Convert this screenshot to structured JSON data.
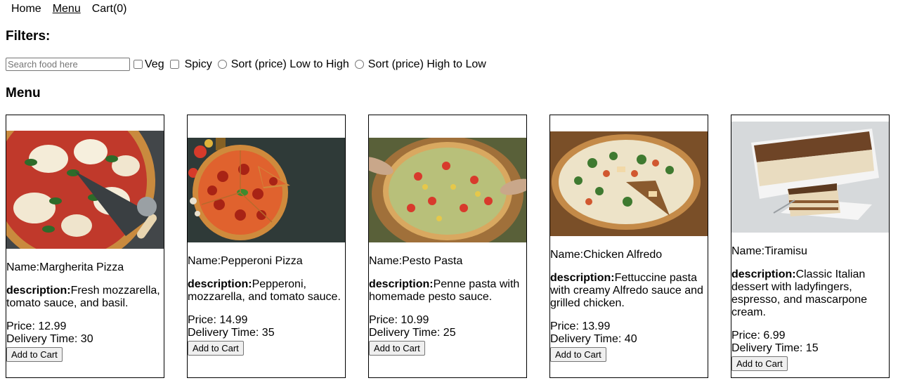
{
  "nav": {
    "home": "Home",
    "menu": "Menu",
    "cart": "Cart(0)"
  },
  "filters": {
    "heading": "Filters:",
    "search_placeholder": "Search food here",
    "veg_label": "Veg",
    "spicy_label": "Spicy",
    "sort_low_high_label": "Sort (price) Low to High",
    "sort_high_low_label": "Sort (price) High to Low"
  },
  "menu": {
    "heading": "Menu",
    "items": [
      {
        "name": "Name:Margherita Pizza",
        "desc_label": "description:",
        "desc": "Fresh mozzarella, tomato sauce, and basil.",
        "price": "Price: 12.99",
        "delivery": "Delivery Time: 30",
        "button": "Add to Cart",
        "image": "margherita-pizza-photo"
      },
      {
        "name": "Name:Pepperoni Pizza",
        "desc_label": "description:",
        "desc": "Pepperoni, mozzarella, and tomato sauce.",
        "price": "Price: 14.99",
        "delivery": "Delivery Time: 35",
        "button": "Add to Cart",
        "image": "pepperoni-pizza-photo"
      },
      {
        "name": "Name:Pesto Pasta",
        "desc_label": "description:",
        "desc": "Penne pasta with homemade pesto sauce.",
        "price": "Price: 10.99",
        "delivery": "Delivery Time: 25",
        "button": "Add to Cart",
        "image": "pesto-pizza-photo"
      },
      {
        "name": "Name:Chicken Alfredo",
        "desc_label": "description:",
        "desc": "Fettuccine pasta with creamy Alfredo sauce and grilled chicken.",
        "price": "Price: 13.99",
        "delivery": "Delivery Time: 40",
        "button": "Add to Cart",
        "image": "chicken-alfredo-pizza-photo"
      },
      {
        "name": "Name:Tiramisu",
        "desc_label": "description:",
        "desc": "Classic Italian dessert with ladyfingers, espresso, and mascarpone cream.",
        "price": "Price: 6.99",
        "delivery": "Delivery Time: 15",
        "button": "Add to Cart",
        "image": "tiramisu-photo"
      }
    ]
  }
}
